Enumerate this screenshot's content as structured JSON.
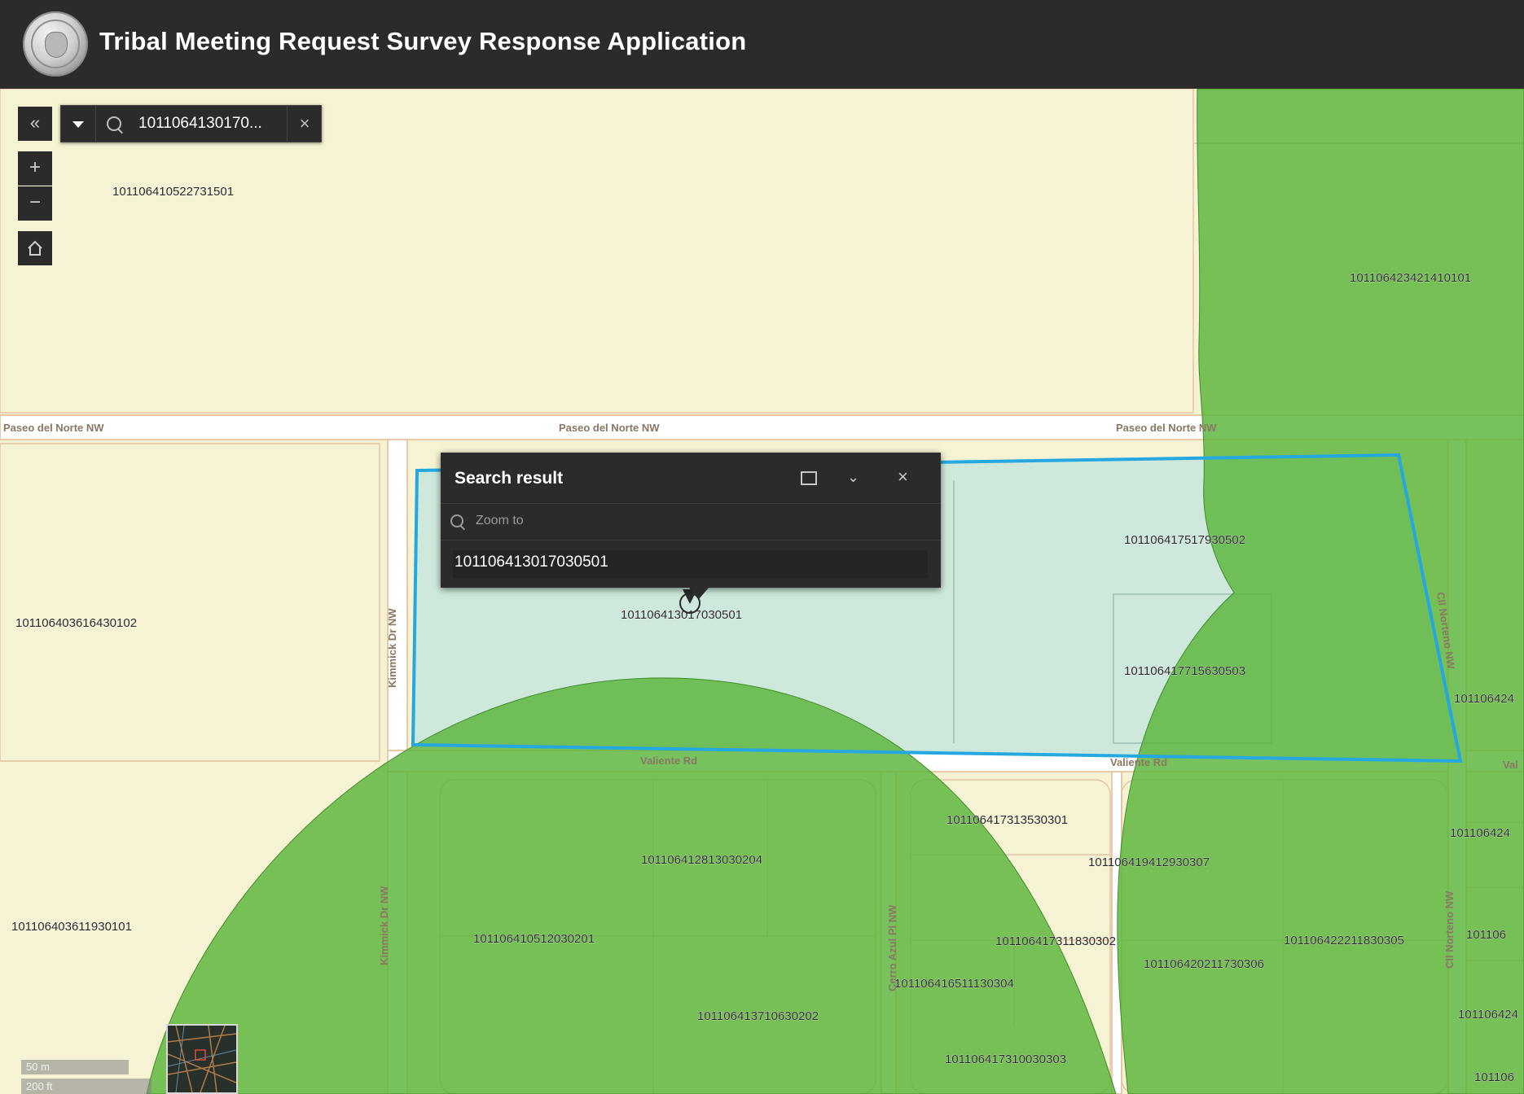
{
  "header": {
    "title": "Tribal Meeting Request Survey Response Application",
    "logo_icon": "city-seal-icon"
  },
  "search": {
    "value": "1011064130170...",
    "collapse_icon": "double-chevron-left-icon",
    "dropdown_icon": "caret-down-icon",
    "search_icon": "search-icon",
    "clear_label": "×"
  },
  "map_controls": {
    "zoom_in_label": "+",
    "zoom_out_label": "−",
    "home_icon": "home-icon"
  },
  "popup": {
    "title": "Search result",
    "zoom_to_label": "Zoom to",
    "result": "101106413017030501",
    "close_label": "×",
    "collapse_label": "⌄",
    "dock_icon": "dock-icon"
  },
  "streets": [
    "Paseo del Norte NW",
    "Paseo del Norte NW",
    "Paseo del Norte NW",
    "Kimmick Dr NW",
    "Valiente Rd",
    "Valiente Rd",
    "Kimmick Dr NW",
    "Cerro Azul Pl NW",
    "Cll Norteno NW",
    "Cll Norteno NW",
    "Val"
  ],
  "parcels": [
    "101106410522731501",
    "101106423421410101",
    "101106403616430102",
    "101106417517930502",
    "101106413017030501",
    "101106417715630503",
    "101106424",
    "101106417313530301",
    "101106412813030204",
    "101106419412930307",
    "101106424",
    "101106403611930101",
    "101106410512030201",
    "101106417311830302",
    "101106422211830305",
    "101106420211730306",
    "101106",
    "101106416511130304",
    "101106413710630202",
    "101106424",
    "101106417310030303",
    "101106"
  ],
  "scale": {
    "metric": "50 m",
    "imperial": "200 ft"
  },
  "colors": {
    "header_bg": "#2b2b2b",
    "map_bg": "#f6f3d4",
    "buffer_green": "#5ab53a",
    "selection_outline": "#25a8e0",
    "selection_fill": "#cbe8dc",
    "road": "#ffffff",
    "road_casing": "#e9c9a6"
  }
}
